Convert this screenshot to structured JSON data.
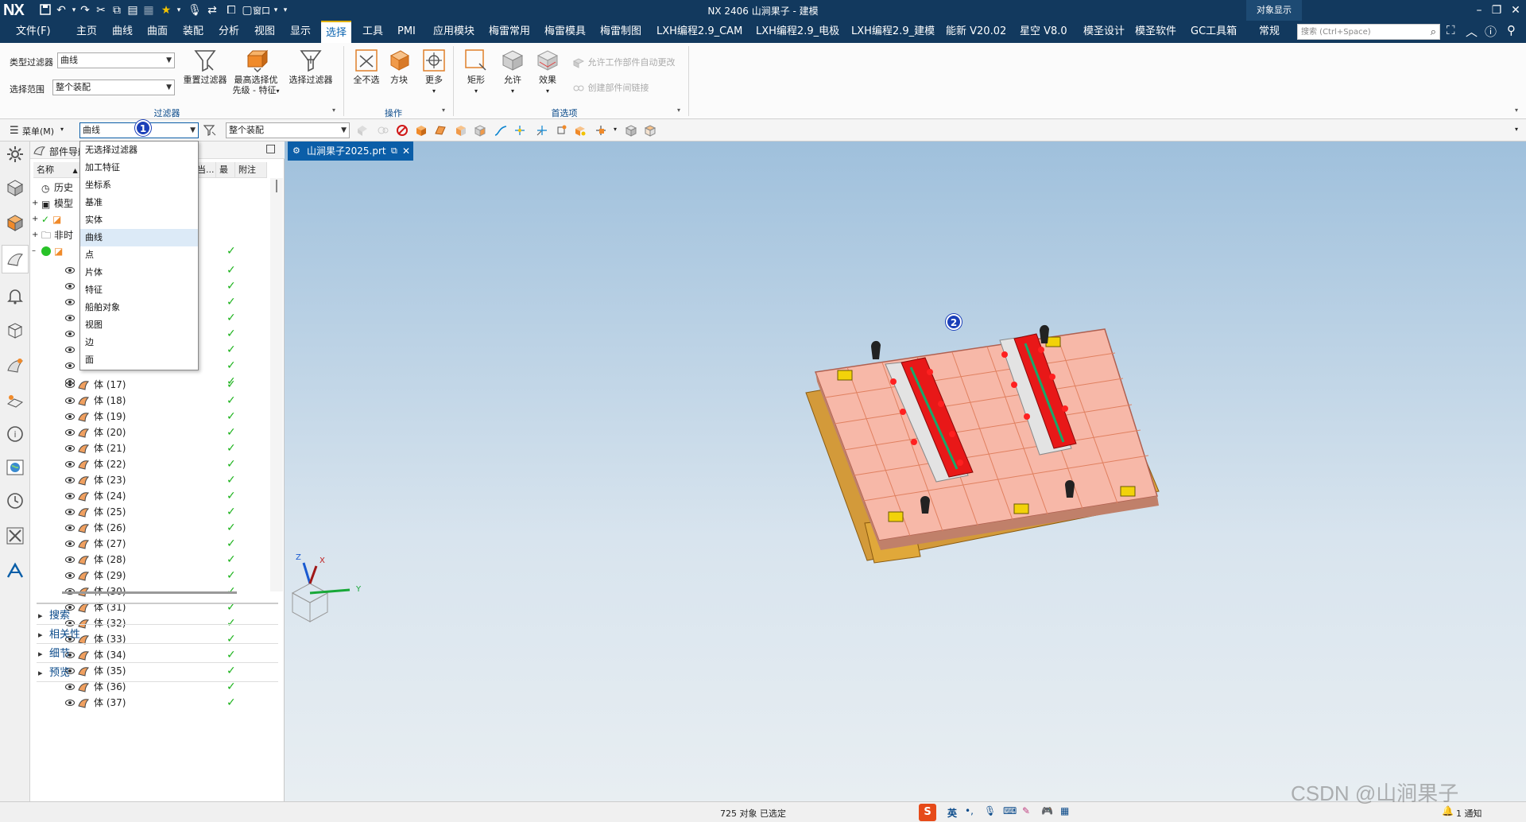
{
  "app": {
    "logo": "NX",
    "title": "NX 2406 山涧果子 - 建模",
    "object_display": "对象显示",
    "window_menu": "窗口"
  },
  "menu": {
    "file": "文件(F)",
    "tabs": [
      "主页",
      "曲线",
      "曲面",
      "装配",
      "分析",
      "视图",
      "显示",
      "选择",
      "工具",
      "PMI",
      "应用模块",
      "梅雷常用",
      "梅雷模具",
      "梅雷制图",
      "LXH编程2.9_CAM",
      "LXH编程2.9_电极",
      "LXH编程2.9_建模",
      "能新 V20.02",
      "星空 V8.0",
      "模圣设计",
      "模圣软件",
      "GC工具箱",
      "常规"
    ],
    "active_tab": "选择",
    "search_placeholder": "搜索 (Ctrl+Space)"
  },
  "ribbon": {
    "type_filter_label": "类型过滤器",
    "type_filter_value": "曲线",
    "scope_label": "选择范围",
    "scope_value": "整个装配",
    "reset_filter": "重置过滤器",
    "highest_priority_1": "最高选择优",
    "highest_priority_2": "先级 - 特征",
    "selection_filter": "选择过滤器",
    "group_filter": "过滤器",
    "deselect_all": "全不选",
    "block": "方块",
    "more": "更多",
    "group_ops": "操作",
    "rectangle": "矩形",
    "allow": "允许",
    "effect": "效果",
    "allow_work_part": "允许工作部件自动更改",
    "create_link": "创建部件间链接",
    "group_prefs": "首选项"
  },
  "selbar": {
    "menu": "菜单(M)",
    "filter_value": "曲线",
    "scope_value": "整个装配"
  },
  "dropdown": {
    "options": [
      "无选择过滤器",
      "加工特征",
      "坐标系",
      "基准",
      "实体",
      "曲线",
      "点",
      "片体",
      "特征",
      "船舶对象",
      "视图",
      "边",
      "面"
    ],
    "selected": "曲线"
  },
  "navigator": {
    "title": "部件导航器",
    "col_name": "名称",
    "col_current": "当...",
    "col_latest": "最",
    "col_note": "附注",
    "top_rows": [
      "历史",
      "模型",
      "",
      "非时"
    ],
    "bodies": [
      "体 (17)",
      "体 (18)",
      "体 (19)",
      "体 (20)",
      "体 (21)",
      "体 (22)",
      "体 (23)",
      "体 (24)",
      "体 (25)",
      "体 (26)",
      "体 (27)",
      "体 (28)",
      "体 (29)",
      "体 (30)",
      "体 (31)",
      "体 (32)",
      "体 (33)",
      "体 (34)",
      "体 (35)",
      "体 (36)",
      "体 (37)"
    ],
    "sections": [
      "搜索",
      "相关性",
      "细节",
      "预览"
    ]
  },
  "viewport": {
    "tab_label": "山涧果子2025.prt",
    "axis_z": "Z",
    "axis_x": "X",
    "axis_y": "Y"
  },
  "badges": {
    "one": "1",
    "two": "2"
  },
  "status": {
    "selected": "725 对象 已选定",
    "notify": "1 通知",
    "ime_lang": "英",
    "watermark": "CSDN @山涧果子"
  },
  "colors": {
    "brand": "#12395e",
    "accent": "#0b5ea8",
    "badge": "#1b3fb8"
  }
}
